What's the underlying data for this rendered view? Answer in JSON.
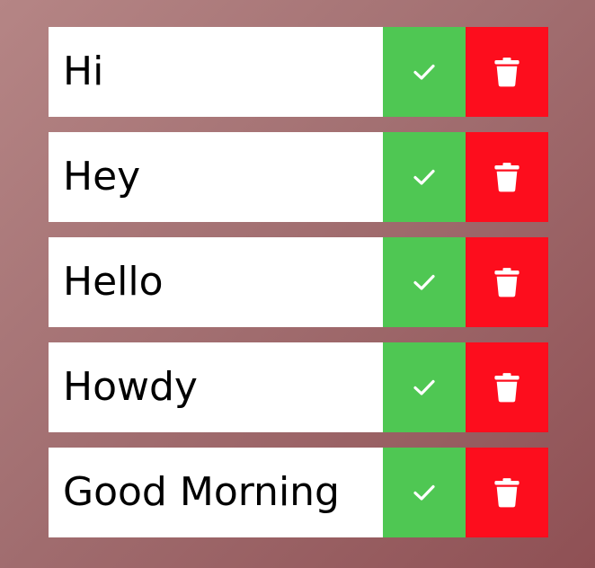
{
  "colors": {
    "complete": "#4fc753",
    "trash": "#fd0d1d",
    "item_background": "#ffffff"
  },
  "todos": [
    {
      "text": "Hi",
      "complete_icon": "check-icon",
      "trash_icon": "trash-icon"
    },
    {
      "text": "Hey",
      "complete_icon": "check-icon",
      "trash_icon": "trash-icon"
    },
    {
      "text": "Hello",
      "complete_icon": "check-icon",
      "trash_icon": "trash-icon"
    },
    {
      "text": "Howdy",
      "complete_icon": "check-icon",
      "trash_icon": "trash-icon"
    },
    {
      "text": "Good Morning",
      "complete_icon": "check-icon",
      "trash_icon": "trash-icon"
    }
  ]
}
